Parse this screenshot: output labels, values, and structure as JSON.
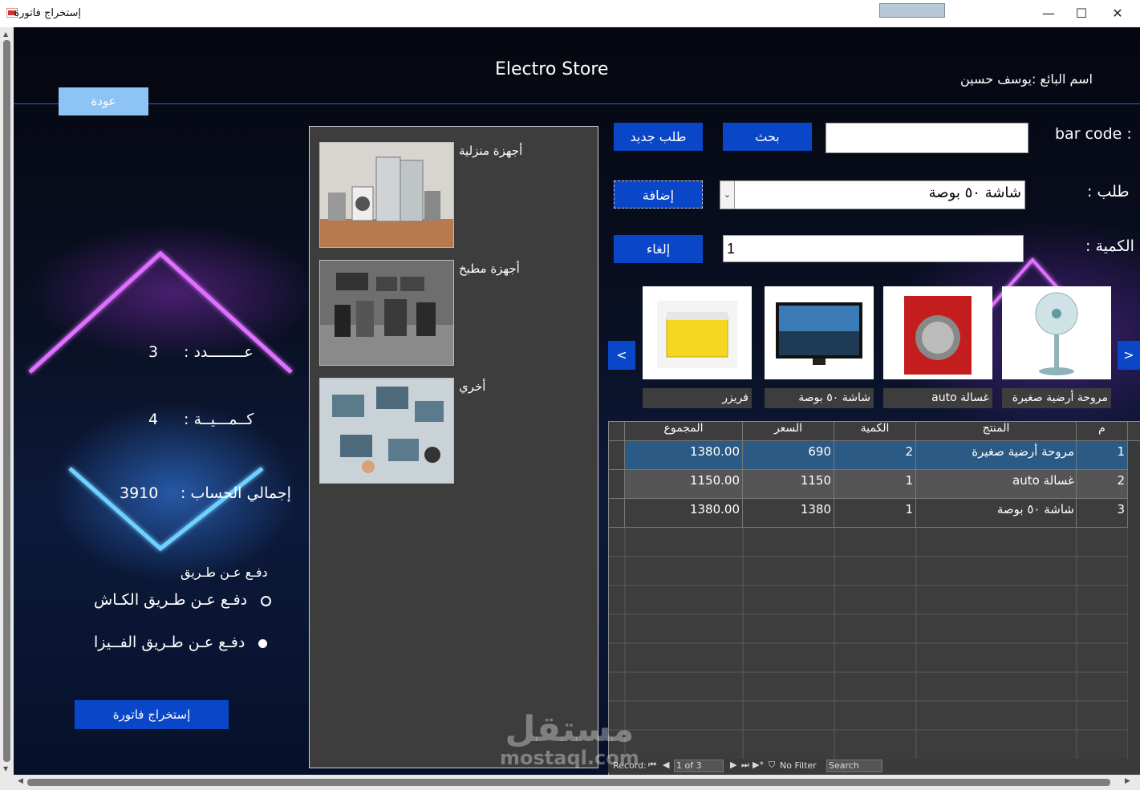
{
  "window": {
    "title": "إستخراج فاتورة",
    "minimize": "—",
    "maximize": "☐",
    "close": "✕"
  },
  "header": {
    "store_name": "Electro Store",
    "seller_label": "اسم البائع :يوسف حسين",
    "back_label": "عودة"
  },
  "summary": {
    "count_label": "عــــــــدد :",
    "count_value": "3",
    "quantity_label": "كــمـــيــة :",
    "quantity_value": "4",
    "total_label": "إجمالي الحساب :",
    "total_value": "3910",
    "payment_title": "دفـع عـن طـريق",
    "payment_cash": "دفـع عـن طـريق الكـاش",
    "payment_visa": "دفـع عـن طـريق الفــيزا",
    "payment_selected": "visa",
    "export_label": "إستخراج فاتورة"
  },
  "categories": [
    {
      "label": "أجهزة منزلية",
      "icon": "home-appliances-image"
    },
    {
      "label": "أجهزة مطبخ",
      "icon": "kitchen-appliances-image"
    },
    {
      "label": "أخري",
      "icon": "other-devices-image"
    }
  ],
  "form": {
    "barcode_label": "bar code :",
    "barcode_value": "",
    "search_label": "بحث",
    "new_order_label": "طلب جديد",
    "order_label": "طلب :",
    "order_value": "شاشة ٥٠ بوصة",
    "add_label": "إضافة",
    "quantity_label": "الكمية :",
    "quantity_value": "1",
    "cancel_label": "إلغاء"
  },
  "products": [
    {
      "name": "فريزر",
      "icon": "freezer-image"
    },
    {
      "name": "شاشة ٥٠ بوصة",
      "icon": "tv-screen-image"
    },
    {
      "name": "غسالة auto",
      "icon": "washing-machine-image"
    },
    {
      "name": "مروحة أرضية صغيرة",
      "icon": "floor-fan-image"
    }
  ],
  "carousel": {
    "prev": "<",
    "next": ">"
  },
  "table": {
    "headers": {
      "index": "م",
      "product": "المنتج",
      "quantity": "الكمية",
      "price": "السعر",
      "total": "المجموع"
    },
    "rows": [
      {
        "index": "1",
        "product": "مروحة أرضية صغيرة",
        "quantity": "2",
        "price": "690",
        "total": "1380.00"
      },
      {
        "index": "2",
        "product": "غسالة auto",
        "quantity": "1",
        "price": "1150",
        "total": "1150.00"
      },
      {
        "index": "3",
        "product": "شاشة ٥٠ بوصة",
        "quantity": "1",
        "price": "1380",
        "total": "1380.00"
      }
    ],
    "selected_row": 0
  },
  "record_nav": {
    "record_label": "Record:",
    "position": "1 of 3",
    "filter_label": "No Filter",
    "search_placeholder": "Search"
  },
  "watermark": {
    "arabic": "مستقل",
    "latin": "mostaql.com"
  },
  "colors": {
    "button": "#0a47c8",
    "selected_row": "#2b5a85",
    "panel": "#3d3d3d"
  }
}
